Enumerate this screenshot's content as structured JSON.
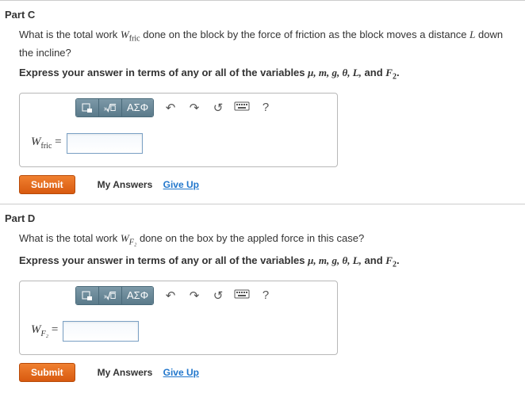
{
  "parts": [
    {
      "title": "Part C",
      "question_pre": "What is the total work ",
      "question_sym_main": "W",
      "question_sym_sub": "fric",
      "question_post": " done on the block by the force of friction as the block moves a distance ",
      "question_tail_sym": "L",
      "question_tail": " down the incline?",
      "instruction_pre": "Express your answer in terms of any or all of the variables ",
      "instruction_vars": "μ, m, g, θ, L,",
      "instruction_and": " and ",
      "instruction_last_main": "F",
      "instruction_last_sub": "2",
      "instruction_end": ".",
      "label_main": "W",
      "label_sub": "fric",
      "label_eq": " = "
    },
    {
      "title": "Part D",
      "question_pre": "What is the total work ",
      "question_sym_main": "W",
      "question_sym_sub": "F₂",
      "question_post": " done on the box by the appled force in this case?",
      "question_tail_sym": "",
      "question_tail": "",
      "instruction_pre": "Express your answer in terms of any or all of the variables ",
      "instruction_vars": "μ, m, g, θ, L,",
      "instruction_and": " and ",
      "instruction_last_main": "F",
      "instruction_last_sub": "2",
      "instruction_end": ".",
      "label_main": "W",
      "label_sub": "F₂",
      "label_eq": " = "
    }
  ],
  "toolbar": {
    "greek": "ΑΣΦ",
    "help": "?"
  },
  "buttons": {
    "submit": "Submit",
    "my_answers": "My Answers",
    "give_up": "Give Up"
  }
}
